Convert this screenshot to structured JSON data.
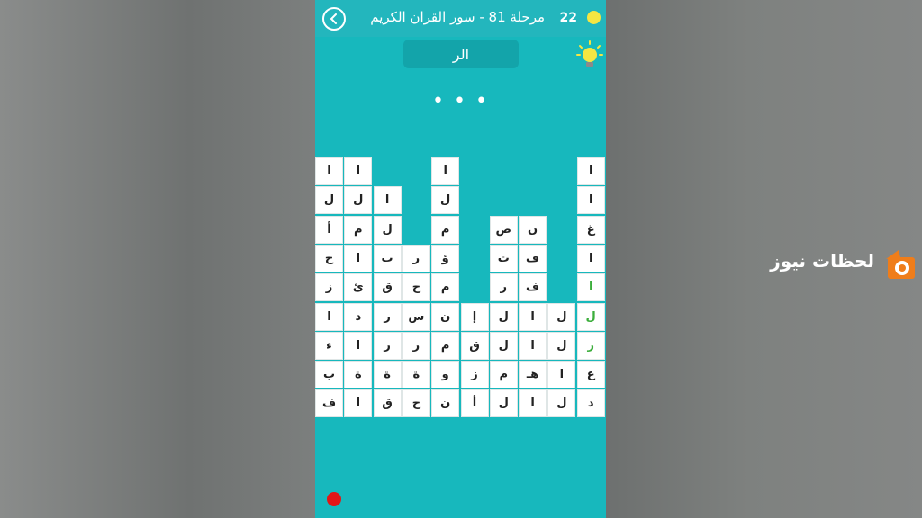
{
  "header": {
    "level_title": "مرحلة 81 - سور القران الكريم",
    "coins": "22"
  },
  "current_word": "الر",
  "progress_dots": "• • •",
  "grid": [
    {
      "r": 0,
      "c": 0,
      "ch": "ا"
    },
    {
      "r": 0,
      "c": 1,
      "ch": "ا"
    },
    {
      "r": 0,
      "c": 4,
      "ch": "ا"
    },
    {
      "r": 0,
      "c": 9,
      "ch": "ا"
    },
    {
      "r": 1,
      "c": 0,
      "ch": "ل"
    },
    {
      "r": 1,
      "c": 1,
      "ch": "ل"
    },
    {
      "r": 1,
      "c": 2,
      "ch": "ا"
    },
    {
      "r": 1,
      "c": 4,
      "ch": "ل"
    },
    {
      "r": 1,
      "c": 9,
      "ch": "ا"
    },
    {
      "r": 2,
      "c": 0,
      "ch": "أ"
    },
    {
      "r": 2,
      "c": 1,
      "ch": "م"
    },
    {
      "r": 2,
      "c": 2,
      "ch": "ل"
    },
    {
      "r": 2,
      "c": 4,
      "ch": "م"
    },
    {
      "r": 2,
      "c": 6,
      "ch": "ص"
    },
    {
      "r": 2,
      "c": 7,
      "ch": "ن"
    },
    {
      "r": 2,
      "c": 9,
      "ch": "غ"
    },
    {
      "r": 3,
      "c": 0,
      "ch": "ح"
    },
    {
      "r": 3,
      "c": 1,
      "ch": "ا"
    },
    {
      "r": 3,
      "c": 2,
      "ch": "ب"
    },
    {
      "r": 3,
      "c": 3,
      "ch": "ر"
    },
    {
      "r": 3,
      "c": 4,
      "ch": "ؤ"
    },
    {
      "r": 3,
      "c": 6,
      "ch": "ت"
    },
    {
      "r": 3,
      "c": 7,
      "ch": "ف"
    },
    {
      "r": 3,
      "c": 9,
      "ch": "ا"
    },
    {
      "r": 4,
      "c": 0,
      "ch": "ز"
    },
    {
      "r": 4,
      "c": 1,
      "ch": "ئ"
    },
    {
      "r": 4,
      "c": 2,
      "ch": "ق"
    },
    {
      "r": 4,
      "c": 3,
      "ch": "ح"
    },
    {
      "r": 4,
      "c": 4,
      "ch": "م"
    },
    {
      "r": 4,
      "c": 6,
      "ch": "ر"
    },
    {
      "r": 4,
      "c": 7,
      "ch": "ف"
    },
    {
      "r": 4,
      "c": 9,
      "ch": "ا",
      "found": true
    },
    {
      "r": 5,
      "c": 0,
      "ch": "ا"
    },
    {
      "r": 5,
      "c": 1,
      "ch": "د"
    },
    {
      "r": 5,
      "c": 2,
      "ch": "ر"
    },
    {
      "r": 5,
      "c": 3,
      "ch": "س"
    },
    {
      "r": 5,
      "c": 4,
      "ch": "ن"
    },
    {
      "r": 5,
      "c": 5,
      "ch": "إ"
    },
    {
      "r": 5,
      "c": 6,
      "ch": "ل"
    },
    {
      "r": 5,
      "c": 7,
      "ch": "ا"
    },
    {
      "r": 5,
      "c": 8,
      "ch": "ل"
    },
    {
      "r": 5,
      "c": 9,
      "ch": "ل",
      "found": true
    },
    {
      "r": 6,
      "c": 0,
      "ch": "ء"
    },
    {
      "r": 6,
      "c": 1,
      "ch": "ا"
    },
    {
      "r": 6,
      "c": 2,
      "ch": "ر"
    },
    {
      "r": 6,
      "c": 3,
      "ch": "ر"
    },
    {
      "r": 6,
      "c": 4,
      "ch": "م"
    },
    {
      "r": 6,
      "c": 5,
      "ch": "ق"
    },
    {
      "r": 6,
      "c": 6,
      "ch": "ل"
    },
    {
      "r": 6,
      "c": 7,
      "ch": "ا"
    },
    {
      "r": 6,
      "c": 8,
      "ch": "ل"
    },
    {
      "r": 6,
      "c": 9,
      "ch": "ر",
      "found": true
    },
    {
      "r": 7,
      "c": 0,
      "ch": "ب"
    },
    {
      "r": 7,
      "c": 1,
      "ch": "ة"
    },
    {
      "r": 7,
      "c": 2,
      "ch": "ة"
    },
    {
      "r": 7,
      "c": 3,
      "ch": "ة"
    },
    {
      "r": 7,
      "c": 4,
      "ch": "و"
    },
    {
      "r": 7,
      "c": 5,
      "ch": "ز"
    },
    {
      "r": 7,
      "c": 6,
      "ch": "م"
    },
    {
      "r": 7,
      "c": 7,
      "ch": "هـ"
    },
    {
      "r": 7,
      "c": 8,
      "ch": "ا"
    },
    {
      "r": 7,
      "c": 9,
      "ch": "ع"
    },
    {
      "r": 8,
      "c": 0,
      "ch": "ف"
    },
    {
      "r": 8,
      "c": 1,
      "ch": "ا"
    },
    {
      "r": 8,
      "c": 2,
      "ch": "ق"
    },
    {
      "r": 8,
      "c": 3,
      "ch": "ح"
    },
    {
      "r": 8,
      "c": 4,
      "ch": "ن"
    },
    {
      "r": 8,
      "c": 5,
      "ch": "أ"
    },
    {
      "r": 8,
      "c": 6,
      "ch": "ل"
    },
    {
      "r": 8,
      "c": 7,
      "ch": "ا"
    },
    {
      "r": 8,
      "c": 8,
      "ch": "ل"
    },
    {
      "r": 8,
      "c": 9,
      "ch": "د"
    }
  ],
  "watermark": {
    "text": "لحظات نيوز"
  },
  "colors": {
    "board_bg": "#17b8bd",
    "found_letter": "#3cae3c",
    "coin": "#f5e642",
    "record_dot": "#e31616"
  }
}
